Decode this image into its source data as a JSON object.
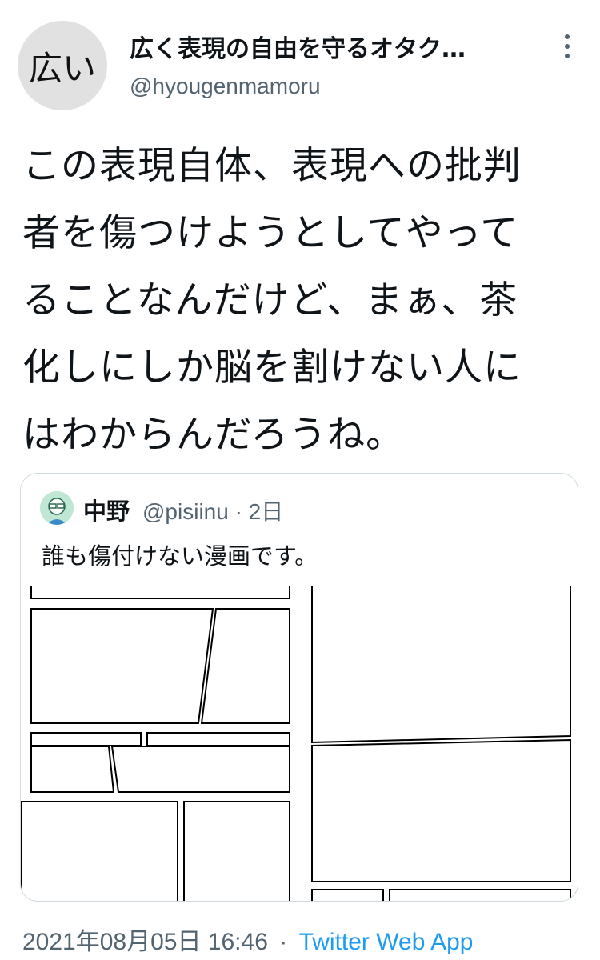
{
  "tweet": {
    "avatar_text": "広い",
    "display_name": "広く表現の自由を守るオタク…",
    "handle": "@hyougenmamoru",
    "text_lines": [
      "この表現自体、表現への批判",
      "者を傷つけようとしてやって",
      "ることなんだけど、まぁ、茶",
      "化しにしか脳を割けない人に",
      "はわからんだろうね。"
    ],
    "timestamp": "2021年08月05日 16:46",
    "separator": "·",
    "source": "Twitter Web App"
  },
  "quote": {
    "name": "中野",
    "handle_time": "@pisiinu · 2日",
    "text": "誰も傷付けない漫画です。"
  },
  "icons": {
    "more": "more-vertical-icon"
  }
}
